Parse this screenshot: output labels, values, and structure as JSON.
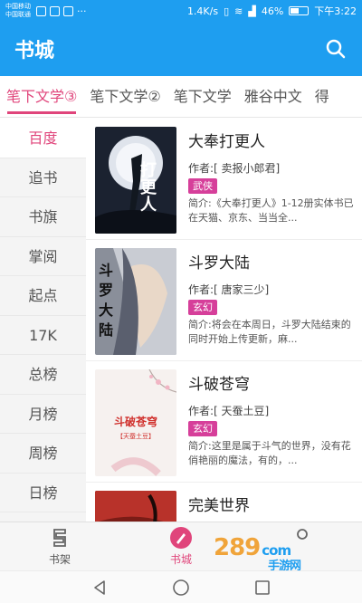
{
  "status_bar": {
    "carrier_1": "中国移动",
    "carrier_2": "中国联通",
    "speed": "1.4K/s",
    "battery": "46%",
    "battery_level": 0.46,
    "time": "下午3:22"
  },
  "app_bar": {
    "title": "书城",
    "search_icon": "search-icon"
  },
  "source_tabs": [
    {
      "label": "笔下文学③",
      "active": true
    },
    {
      "label": "笔下文学②",
      "active": false
    },
    {
      "label": "笔下文学",
      "active": false
    },
    {
      "label": "雅谷中文",
      "active": false
    },
    {
      "label": "得",
      "active": false
    }
  ],
  "sidebar": {
    "items": [
      {
        "label": "百度",
        "active": true
      },
      {
        "label": "追书"
      },
      {
        "label": "书旗"
      },
      {
        "label": "掌阅"
      },
      {
        "label": "起点"
      },
      {
        "label": "17K"
      },
      {
        "label": "总榜"
      },
      {
        "label": "月榜"
      },
      {
        "label": "周榜"
      },
      {
        "label": "日榜"
      }
    ]
  },
  "books": [
    {
      "title": "大奉打更人",
      "author": "作者:[ 卖报小郎君]",
      "tag": "武侠",
      "desc": "简介:《大奉打更人》1-12册实体书已在天猫、京东、当当全...",
      "cover_text": "打更人"
    },
    {
      "title": "斗罗大陆",
      "author": "作者:[ 唐家三少]",
      "tag": "玄幻",
      "desc": "简介:将会在本周日，斗罗大陆结束的同时开始上传更新，麻...",
      "cover_text": "斗罗大陆"
    },
    {
      "title": "斗破苍穹",
      "author": "作者:[ 天蚕土豆]",
      "tag": "玄幻",
      "desc": "简介:这里是属于斗气的世界，没有花俏艳丽的魔法，有的，...",
      "cover_text": "斗破苍穹",
      "cover_subtext": "【天蚕土豆】"
    },
    {
      "title": "完美世界",
      "author": "",
      "tag": "",
      "desc": "",
      "cover_text": ""
    }
  ],
  "bottom_nav": [
    {
      "label": "书架",
      "icon": "bookshelf-icon",
      "active": false
    },
    {
      "label": "书城",
      "icon": "bookstore-icon",
      "active": true
    },
    {
      "label": "",
      "icon": "user-icon",
      "active": false
    }
  ],
  "watermark": {
    "brand": "289",
    "suffix": "com",
    "sub": "手游网"
  },
  "system_nav": {
    "back": "back-icon",
    "home": "home-icon",
    "recent": "recent-apps-icon"
  },
  "colors": {
    "primary": "#1e9ef0",
    "accent": "#e0457b",
    "tag": "#d63f9a"
  }
}
